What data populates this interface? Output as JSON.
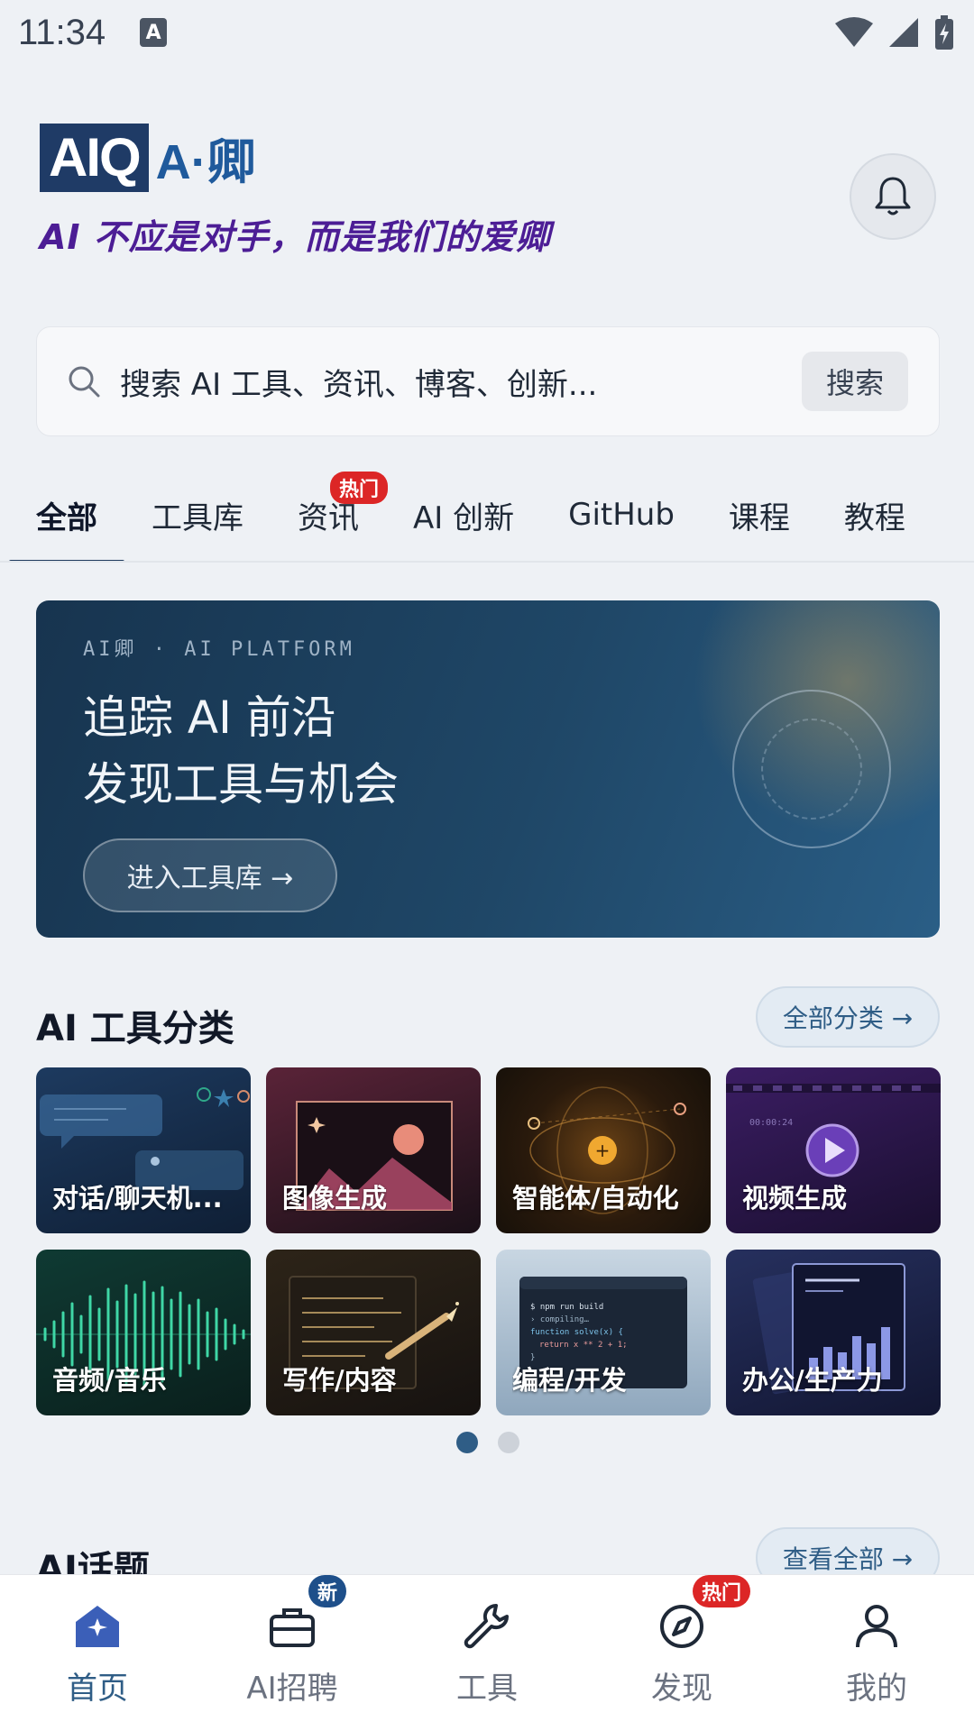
{
  "status_bar": {
    "time": "11:34",
    "keyboard_badge": "A"
  },
  "header": {
    "logo_box": "AIQ",
    "logo_text": "A·卿",
    "slogan": "AI 不应是对手，而是我们的爱卿"
  },
  "search": {
    "placeholder": "搜索 AI 工具、资讯、博客、创新...",
    "button": "搜索"
  },
  "tabs": [
    {
      "label": "全部",
      "active": true
    },
    {
      "label": "工具库"
    },
    {
      "label": "资讯",
      "badge": "热门"
    },
    {
      "label": "AI 创新"
    },
    {
      "label": "GitHub"
    },
    {
      "label": "课程"
    },
    {
      "label": "教程"
    }
  ],
  "banner": {
    "kicker": "AI卿 · AI PLATFORM",
    "line1": "追踪 AI 前沿",
    "line2": "发现工具与机会",
    "cta": "进入工具库 →"
  },
  "tool_categories": {
    "title": "AI 工具分类",
    "all_link": "全部分类 →",
    "items": [
      {
        "label": "对话/聊天机...",
        "icon": "chat-bubble-icon"
      },
      {
        "label": "图像生成",
        "icon": "image-frame-icon"
      },
      {
        "label": "智能体/自动化",
        "icon": "orbit-icon"
      },
      {
        "label": "视频生成",
        "icon": "play-icon"
      },
      {
        "label": "音频/音乐",
        "icon": "waveform-icon"
      },
      {
        "label": "写作/内容",
        "icon": "pen-icon"
      },
      {
        "label": "编程/开发",
        "icon": "terminal-icon"
      },
      {
        "label": "办公/生产力",
        "icon": "bar-chart-icon"
      }
    ],
    "code_card_lines": [
      "$ npm run build",
      "› compiling…",
      "function solve(x) {",
      "return x ** 2 + 1;",
      "}"
    ],
    "video_card_timestamp": "00:00:24",
    "page_count": 2,
    "current_page": 1
  },
  "topics": {
    "title": "AI话题",
    "view_all": "查看全部 →"
  },
  "bottom_nav": [
    {
      "label": "首页",
      "icon": "home-icon",
      "active": true
    },
    {
      "label": "AI招聘",
      "icon": "briefcase-icon",
      "badge": "新"
    },
    {
      "label": "工具",
      "icon": "wrench-icon"
    },
    {
      "label": "发现",
      "icon": "compass-icon",
      "badge": "热门"
    },
    {
      "label": "我的",
      "icon": "user-icon"
    }
  ],
  "colors": {
    "accent": "#2f5d86",
    "slogan": "#4c1d95",
    "hot_badge": "#dc2626",
    "new_badge": "#1e4f8a"
  }
}
